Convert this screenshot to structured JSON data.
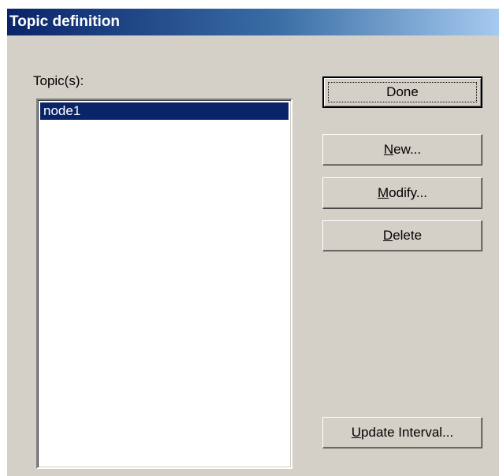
{
  "window": {
    "title": "Topic definition"
  },
  "topics": {
    "label": "Topic(s):",
    "items": [
      {
        "label": "node1",
        "selected": true
      }
    ]
  },
  "buttons": {
    "done": {
      "label": "Done"
    },
    "new": {
      "mnemonic": "N",
      "rest": "ew..."
    },
    "modify": {
      "mnemonic": "M",
      "rest": "odify..."
    },
    "delete": {
      "mnemonic": "D",
      "rest": "elete"
    },
    "update_interval": {
      "mnemonic": "U",
      "rest": "pdate Interval..."
    }
  },
  "colors": {
    "face": "#d4d0c8",
    "title_start": "#0a246a",
    "title_end": "#a6caf0",
    "selection": "#0a246a"
  }
}
